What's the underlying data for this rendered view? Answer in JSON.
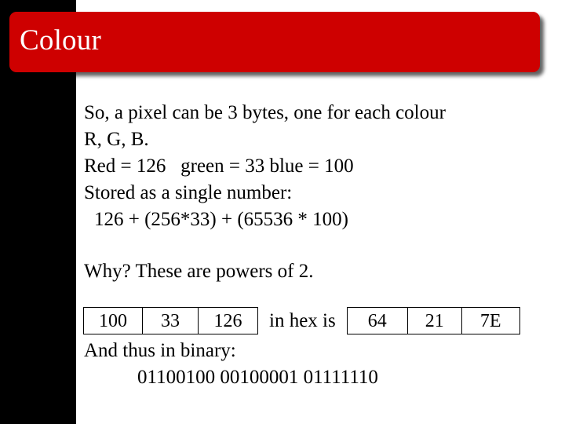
{
  "slide": {
    "title": "Colour",
    "theme": {
      "banner_color": "#ce0000",
      "sidebar_color": "#000000",
      "background_color": "#ffffff",
      "title_color": "#ffffff",
      "body_color": "#000000"
    }
  },
  "body": {
    "lines": [
      "So, a pixel can be 3 bytes, one for each colour",
      "R, G, B.",
      "Red = 126   green = 33 blue = 100",
      "Stored as a single number:",
      "126 + (256*33) + (65536 * 100)"
    ],
    "question_line": "Why? These are powers of 2."
  },
  "tables": {
    "decimal": {
      "cells": [
        "100",
        "33",
        "126"
      ]
    },
    "separator_label": "in hex is",
    "hex": {
      "cells": [
        "64",
        "21",
        "7E"
      ]
    }
  },
  "binary": {
    "label": "And thus in binary:",
    "value": "01100100 00100001 01111110"
  }
}
